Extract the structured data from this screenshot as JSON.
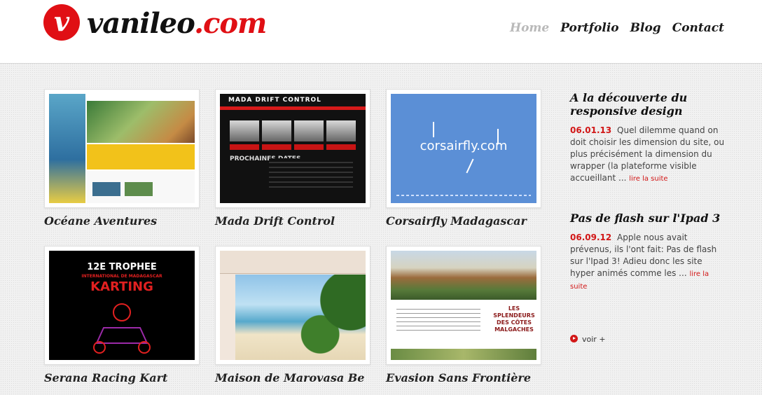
{
  "site": {
    "logo_mark": "v",
    "logo_name": "vanileo",
    "logo_tld": ".com"
  },
  "nav": {
    "items": [
      {
        "label": "Home",
        "active": true
      },
      {
        "label": "Portfolio",
        "active": false
      },
      {
        "label": "Blog",
        "active": false
      },
      {
        "label": "Contact",
        "active": false
      }
    ]
  },
  "portfolio": {
    "items": [
      {
        "title": "Océane Aventures"
      },
      {
        "title": "Mada Drift Control"
      },
      {
        "title": "Corsairfly Madagascar"
      },
      {
        "title": "Serana Racing Kart"
      },
      {
        "title": "Maison de Marovasa Be"
      },
      {
        "title": "Evasion Sans Frontière"
      }
    ]
  },
  "thumbnails": {
    "mada_brand": "MADA DRIFT CONTROL",
    "mada_dates": "PROCHAINES DATES",
    "corsair_brand": "corsairfly.com",
    "serana_line1": "12E TROPHEE",
    "serana_line2": "INTERNATIONAL DE MADAGASCAR",
    "serana_line3": "KARTING",
    "evasion_head": "LES SPLENDEURS DES CÔTES MALGACHES"
  },
  "blog": {
    "posts": [
      {
        "title": "A la découverte du responsive design",
        "date": "06.01.13",
        "excerpt": "Quel dilemme quand on doit choisir les dimension du site, ou plus précisément la dimension du wrapper (la plateforme visible accueillant ...",
        "more": "lire la suite"
      },
      {
        "title": "Pas de flash sur l'Ipad 3",
        "date": "06.09.12",
        "excerpt": "Apple nous avait prévenus, ils l'ont fait: Pas de flash sur l'Ipad 3! Adieu donc les site hyper animés comme les ...",
        "more": "lire la suite"
      }
    ],
    "see_more": "voir +"
  },
  "colors": {
    "brand_red": "#e00f14",
    "link_red": "#d21717",
    "nav_active": "#b9b9b9"
  }
}
